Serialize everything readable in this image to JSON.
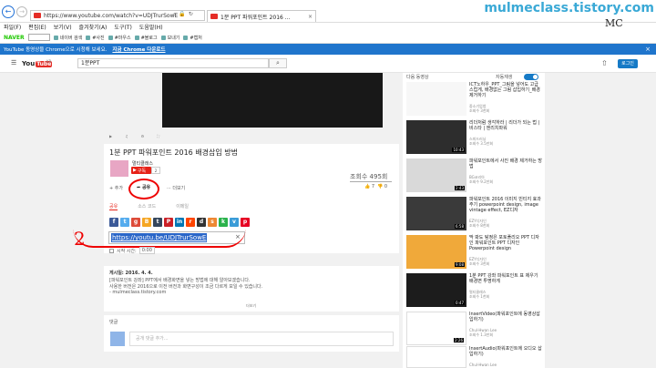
{
  "browser": {
    "address": "https://www.youtube.com/watch?v=UDJTrurSowE",
    "tab_title": "1분 PPT 파워포인트 2016 ...",
    "menu": [
      "파일(F)",
      "편집(E)",
      "보기(V)",
      "즐겨찾기(A)",
      "도구(T)",
      "도움말(H)"
    ],
    "favbar": {
      "naver": "NAVER",
      "items": [
        "네이버 검색",
        "#사진",
        "#마우스",
        "#블로그",
        "보내기",
        "#캡처"
      ]
    },
    "watermark": "mulmeclass.tistory.com",
    "signature": "MC"
  },
  "infobar": {
    "text": "YouTube 동영상을 Chrome으로 시청해 보세요.",
    "link": "지금 Chrome 다운로드"
  },
  "yt": {
    "logo_you": "You",
    "logo_tube": "Tube",
    "logo_kr": "KR",
    "search_value": "1분PPT",
    "login": "로그인"
  },
  "video": {
    "title": "1분 PPT 파워포인트 2016 배경삽입 방법",
    "channel": "멀티클래스",
    "subscribe": "구독",
    "sub_count": "2",
    "views": "조회수 495회",
    "add_label": "추가",
    "share_label": "공유",
    "more_label": "더보기",
    "like_count": "7",
    "dislike_count": "0",
    "share_tabs": [
      "공유",
      "소스 코드",
      "이메일"
    ],
    "share_url": "https://youtu.be/UDJTrurSowE",
    "start_time_label": "시작 시간:",
    "start_time_value": "0:00",
    "annotation_number": "2",
    "published": "게시일: 2016. 4. 4.",
    "desc_lines": [
      "[파워포인트 강좌] PPT에서 배경화면을 넣는 방법에 대해 알아보겠습니다.",
      "사용한 버전은 2016으로 이전 버전과 화면구성이 조금 다르게 보일 수 있습니다.",
      "- mulmeclass.tistory.com"
    ],
    "desc_more": "더보기",
    "comments_label": "댓글",
    "comment_placeholder": "공개 댓글 추가..."
  },
  "sidebar": {
    "next_label": "다음 동영상",
    "autoplay_label": "자동재생",
    "items": [
      {
        "title": "ICT노하우_PPT_그림을 넣어도 고급스럽게, 배경없는 그림 삽입하기_배경제거하기",
        "meta": [
          "중소기업청",
          "조회수 3천회"
        ],
        "duration": "",
        "thumb": "#f7f7f7"
      },
      {
        "title": "리더처럼 생각하라 | 리더가 되는 법 | 비스타 | 엔리치파워",
        "meta": [
          "스피드러닝",
          "조회수 3.5만회"
        ],
        "duration": "10:43",
        "thumb": "#2d2d2d"
      },
      {
        "title": "파워포인트에서 사진 배경 제거하는 방법",
        "meta": [
          "BG코리아",
          "조회수 9.2만회"
        ],
        "duration": "2:43",
        "thumb": "#d9d9d9"
      },
      {
        "title": "파워포인트 2016 이미지 빈티지 효과주기 powerpoint design, image vintage effect, EZ디자",
        "meta": [
          "EZY디자인",
          "조회수 8천회"
        ],
        "duration": "6:58",
        "thumb": "#3a3a3a"
      },
      {
        "title": "딱 봐도 탐정은 포토폴리오 PPT 디자인 파워포인트 PPT 디자인 Powerpoint design",
        "meta": [
          "EZY디자인",
          "조회수 3천회"
        ],
        "duration": "9:08",
        "thumb": "#f0a93a"
      },
      {
        "title": "1분 PPT 강좌 파워포인트 표 제우기 배경면 투명하게",
        "meta": [
          "멀티클래스",
          "조회수 1천회"
        ],
        "duration": "0:47",
        "thumb": "#1c1c1c"
      },
      {
        "title": "InsertVideo(파워포인트에 동영상삽입하기)",
        "meta": [
          "Chul-Hwan Lee",
          "조회수 1.3만회"
        ],
        "duration": "2:26",
        "thumb": "#ffffff"
      },
      {
        "title": "InsertAudio(파워포인트에 오디오 삽입하기)",
        "meta": [
          "Chul-Hwan Lee"
        ],
        "duration": "",
        "thumb": "#ffffff"
      }
    ]
  },
  "colors": {
    "youtube_red": "#e62117",
    "ie_blue": "#1f75cc",
    "annotation_red": "#ee0000",
    "link_blue": "#167ac6"
  }
}
